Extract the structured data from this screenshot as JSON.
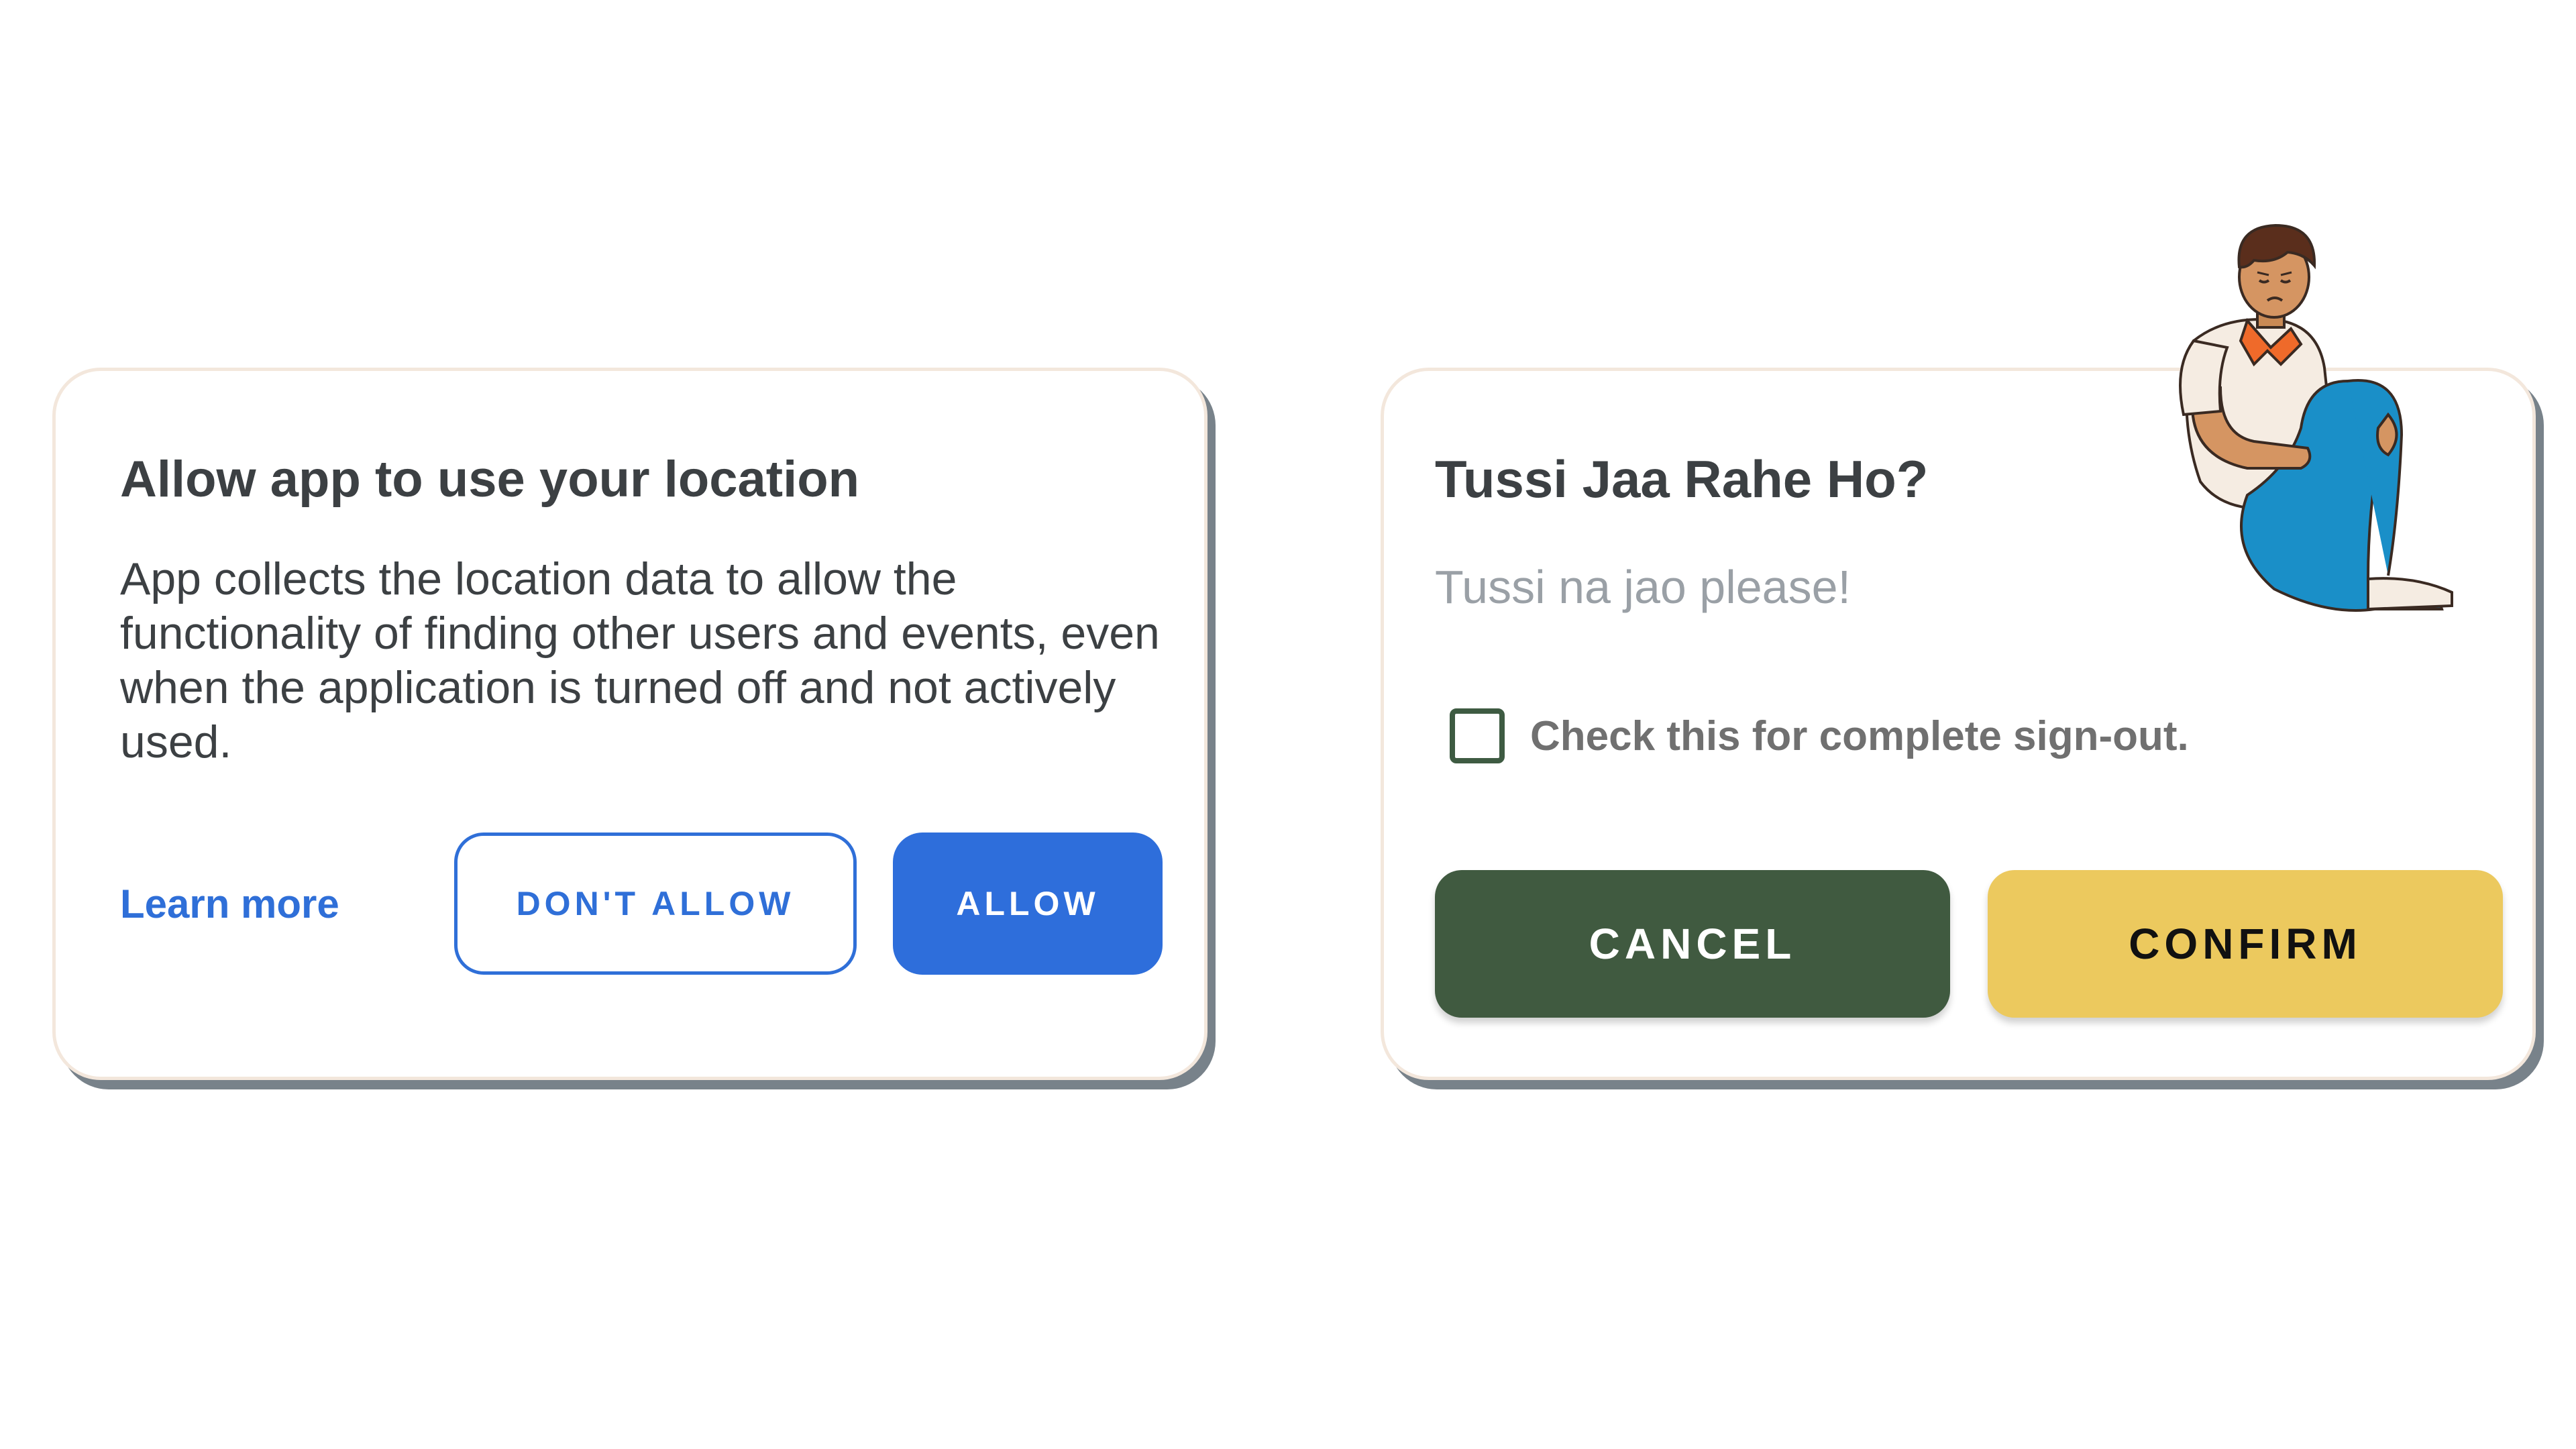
{
  "location_dialog": {
    "title": "Allow app to use your location",
    "body": "App collects the location data to allow the functionality of finding other users and events, even when the application is turned off and not actively used.",
    "learn_more_label": "Learn more",
    "dont_allow_label": "DON'T ALLOW",
    "allow_label": "ALLOW"
  },
  "signout_dialog": {
    "title": "Tussi Jaa Rahe Ho?",
    "subtitle": "Tussi na jao please!",
    "checkbox_label": "Check this for complete sign-out.",
    "checkbox_checked": false,
    "cancel_label": "CANCEL",
    "confirm_label": "CONFIRM",
    "illustration_icon": "sad-person-sitting-icon"
  },
  "colors": {
    "primary_blue": "#2e6edb",
    "cancel_green": "#405a40",
    "confirm_yellow": "#ecc95e",
    "card_shadow": "#78828a"
  }
}
